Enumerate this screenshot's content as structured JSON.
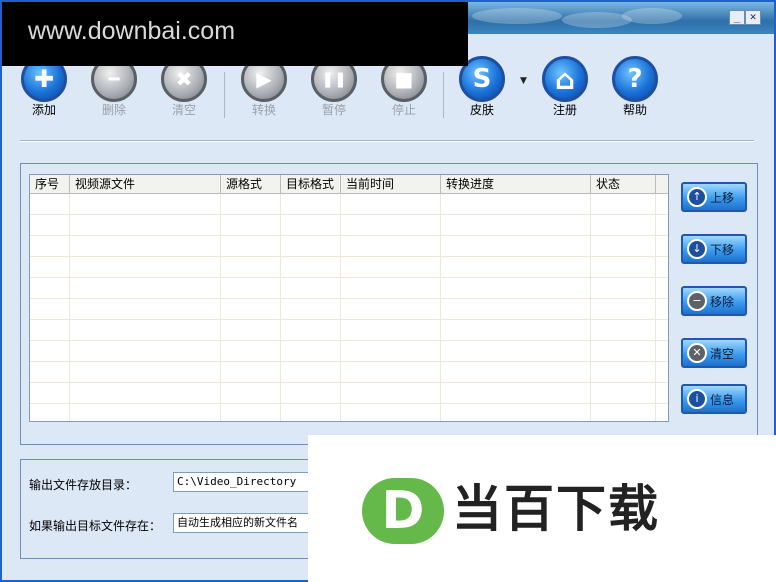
{
  "window": {
    "minimize_glyph": "_",
    "close_glyph": "✕"
  },
  "watermarks": {
    "top_url": "www.downbai.com",
    "logo_letter": "D",
    "logo_text": "当百下载",
    "logo_color": "#64b94a"
  },
  "toolbar": {
    "add": {
      "label": "添加",
      "icon": "plus-icon",
      "glyph": "✚"
    },
    "delete": {
      "label": "删除",
      "icon": "minus-icon",
      "glyph": "━"
    },
    "clear": {
      "label": "清空",
      "icon": "x-icon",
      "glyph": "✖"
    },
    "convert": {
      "label": "转换",
      "icon": "play-icon",
      "glyph": "▶"
    },
    "pause": {
      "label": "暂停",
      "icon": "pause-icon",
      "glyph": "❚❚"
    },
    "stop": {
      "label": "停止",
      "icon": "stop-icon",
      "glyph": "■"
    },
    "skin": {
      "label": "皮肤",
      "icon": "skin-s-icon",
      "glyph": "S"
    },
    "skin_caret": "▼",
    "register": {
      "label": "注册",
      "icon": "home-icon",
      "glyph": "⌂"
    },
    "help": {
      "label": "帮助",
      "icon": "question-icon",
      "glyph": "?"
    }
  },
  "list": {
    "columns": [
      "序号",
      "视频源文件",
      "源格式",
      "目标格式",
      "当前时间",
      "转换进度",
      "状态"
    ]
  },
  "side_buttons": {
    "up": {
      "label": "上移",
      "icon": "arrow-up-icon",
      "glyph": "↑"
    },
    "down": {
      "label": "下移",
      "icon": "arrow-down-icon",
      "glyph": "↓"
    },
    "remove": {
      "label": "移除",
      "icon": "minus-circle-icon",
      "glyph": "−"
    },
    "clear": {
      "label": "清空",
      "icon": "x-circle-icon",
      "glyph": "✕"
    },
    "info": {
      "label": "信息",
      "icon": "info-icon",
      "glyph": "i"
    }
  },
  "output": {
    "dir_label": "输出文件存放目录：",
    "dir_value": "C:\\Video_Directory",
    "exists_label": "如果输出目标文件存在：",
    "exists_value": "自动生成相应的新文件名"
  },
  "colors": {
    "accent": "#1a72d8",
    "disabled": "#a9adb3",
    "panel_bg": "#dce8f6"
  }
}
